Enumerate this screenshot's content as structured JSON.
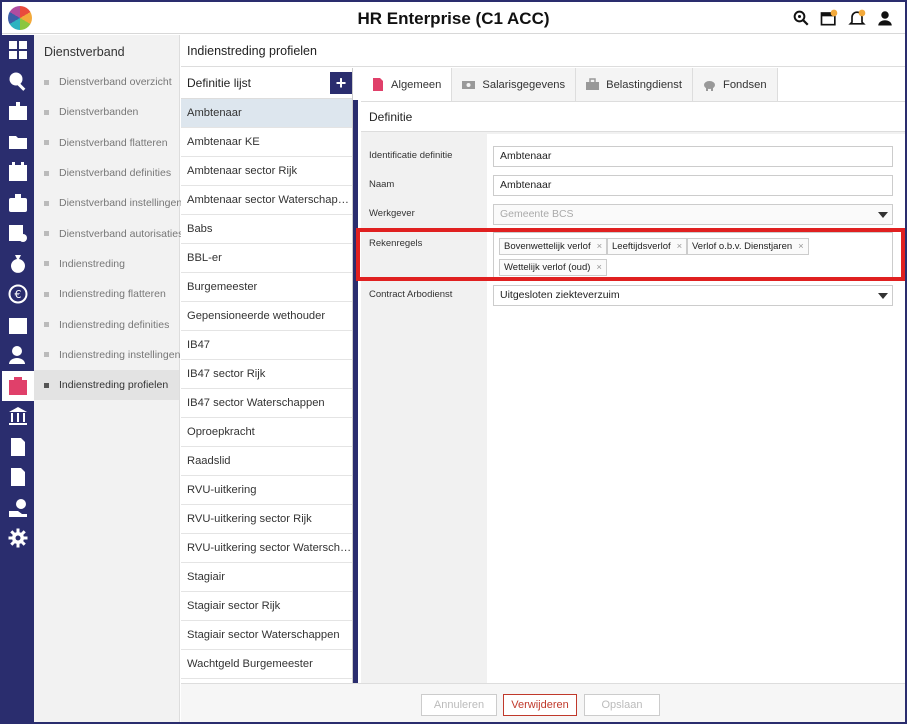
{
  "app": {
    "title": "HR Enterprise (C1 ACC)"
  },
  "top_icons": [
    "search-icon",
    "calendar-alert-icon",
    "bell-icon",
    "user-icon"
  ],
  "rail_icons": [
    "grid-icon",
    "search-icon",
    "id-card-icon",
    "folder-icon",
    "calendar-icon",
    "medical-bag-icon",
    "checklist-icon",
    "money-bag-icon",
    "euro-cycle-icon",
    "calendar-clock-icon",
    "user-switch-icon",
    "user-profile-icon",
    "bank-icon",
    "document-icon",
    "euro-document-icon",
    "hand-money-icon",
    "gear-icon"
  ],
  "subnav": {
    "title": "Dienstverband",
    "items": [
      "Dienstverband overzicht",
      "Dienstverbanden",
      "Dienstverband flatteren",
      "Dienstverband definities",
      "Dienstverband instellingen",
      "Dienstverband autorisaties",
      "Indienstreding",
      "Indienstreding flatteren",
      "Indienstreding definities",
      "Indienstreding instellingen",
      "Indienstreding profielen"
    ]
  },
  "page": {
    "title": "Indienstreding profielen"
  },
  "list": {
    "title": "Definitie lijst",
    "add_label": "+",
    "items": [
      "Ambtenaar",
      "Ambtenaar KE",
      "Ambtenaar sector Rijk",
      "Ambtenaar sector Waterschappen",
      "Babs",
      "BBL-er",
      "Burgemeester",
      "Gepensioneerde wethouder",
      "IB47",
      "IB47 sector Rijk",
      "IB47 sector Waterschappen",
      "Oproepkracht",
      "Raadslid",
      "RVU-uitkering",
      "RVU-uitkering sector Rijk",
      "RVU-uitkering sector Waterschappen",
      "Stagiair",
      "Stagiair sector Rijk",
      "Stagiair sector Waterschappen",
      "Wachtgeld Burgemeester"
    ]
  },
  "tabs": [
    {
      "label": "Algemeen",
      "icon": "document-icon"
    },
    {
      "label": "Salarisgegevens",
      "icon": "money-icon"
    },
    {
      "label": "Belastingdienst",
      "icon": "briefcase-icon"
    },
    {
      "label": "Fondsen",
      "icon": "piggy-bank-icon"
    }
  ],
  "section": {
    "title": "Definitie"
  },
  "form": {
    "identificatie_label": "Identificatie definitie",
    "identificatie_value": "Ambtenaar",
    "naam_label": "Naam",
    "naam_value": "Ambtenaar",
    "werkgever_label": "Werkgever",
    "werkgever_value": "Gemeente BCS",
    "rekenregels_label": "Rekenregels",
    "rekenregels_tags": [
      "Bovenwettelijk verlof",
      "Leeftijdsverlof",
      "Verlof o.b.v. Dienstjaren",
      "Wettelijk verlof (oud)"
    ],
    "tag_remove": "×",
    "contract_label": "Contract Arbodienst",
    "contract_value": "Uitgesloten ziekteverzuim"
  },
  "footer": {
    "cancel_label": "Annuleren",
    "delete_label": "Verwijderen",
    "save_label": "Opslaan"
  },
  "colors": {
    "brand": "#2a2d6e",
    "accent": "#e0406a",
    "highlight": "#e02020",
    "danger": "#c0392b"
  }
}
